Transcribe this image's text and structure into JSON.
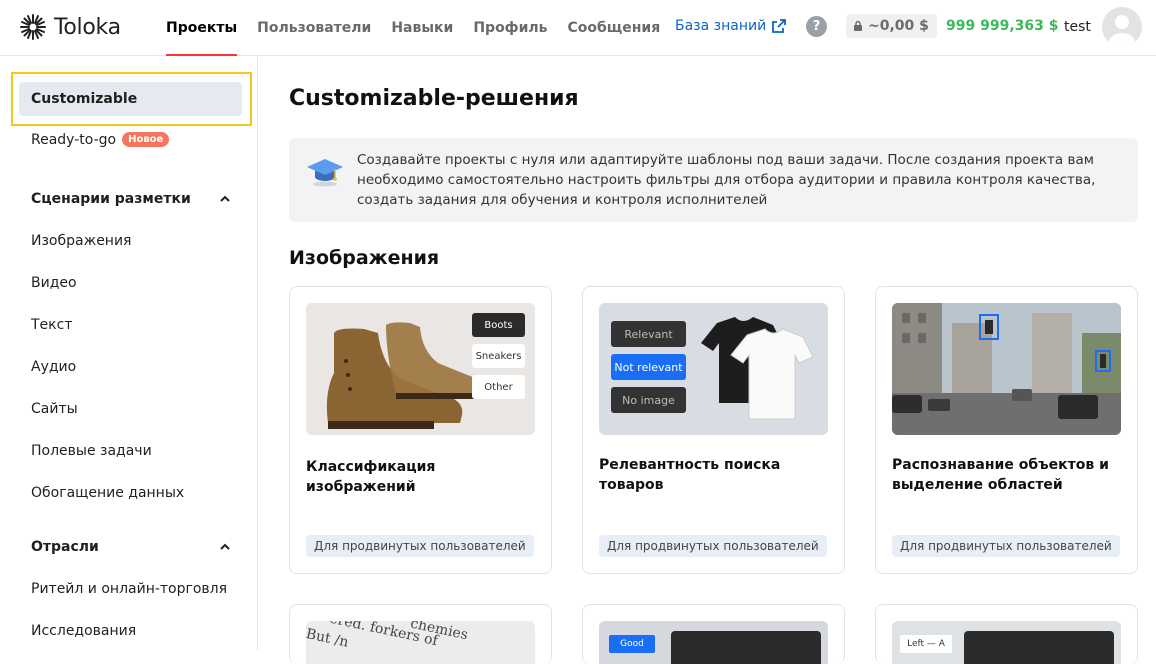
{
  "header": {
    "logo": "Toloka",
    "nav": [
      "Проекты",
      "Пользователи",
      "Навыки",
      "Профиль",
      "Сообщения"
    ],
    "knowledge_base": "База знаний",
    "help": "?",
    "locked_balance": "~0,00 $",
    "balance": "999 999,363 $",
    "user": "test"
  },
  "sidebar": {
    "customizable": "Customizable",
    "ready": "Ready-to-go",
    "new_badge": "Новое",
    "scenarios_title": "Сценарии разметки",
    "scenarios": [
      "Изображения",
      "Видео",
      "Текст",
      "Аудио",
      "Сайты",
      "Полевые задачи",
      "Обогащение данных"
    ],
    "industries_title": "Отрасли",
    "industries": [
      "Ритейл и онлайн-торговля",
      "Исследования"
    ]
  },
  "main": {
    "title": "Customizable-решения",
    "info": "Создавайте проекты с нуля или адаптируйте шаблоны под ваши задачи. После создания проекта вам необходимо самостоятельно настроить фильтры для отбора аудитории и правила контроля качества, создать задания для обучения и контроля исполнителей",
    "section": "Изображения",
    "cards": [
      {
        "title": "Классификация изображений",
        "tag": "Для продвинутых пользователей",
        "labels": [
          "Boots",
          "Sneakers",
          "Other"
        ]
      },
      {
        "title": "Релевантность поиска товаров",
        "tag": "Для продвинутых пользователей",
        "labels": [
          "Relevant",
          "Not relevant",
          "No image"
        ]
      },
      {
        "title": "Распознавание объектов и выделение областей",
        "tag": "Для продвинутых пользователей"
      }
    ],
    "card_row2_labels": [
      "Good",
      "Left — A"
    ]
  },
  "colors": {
    "accent_red": "#ff3333",
    "balance_green": "#3cb95a",
    "link_blue": "#0e64c4",
    "focus_yellow": "#f5c518"
  }
}
